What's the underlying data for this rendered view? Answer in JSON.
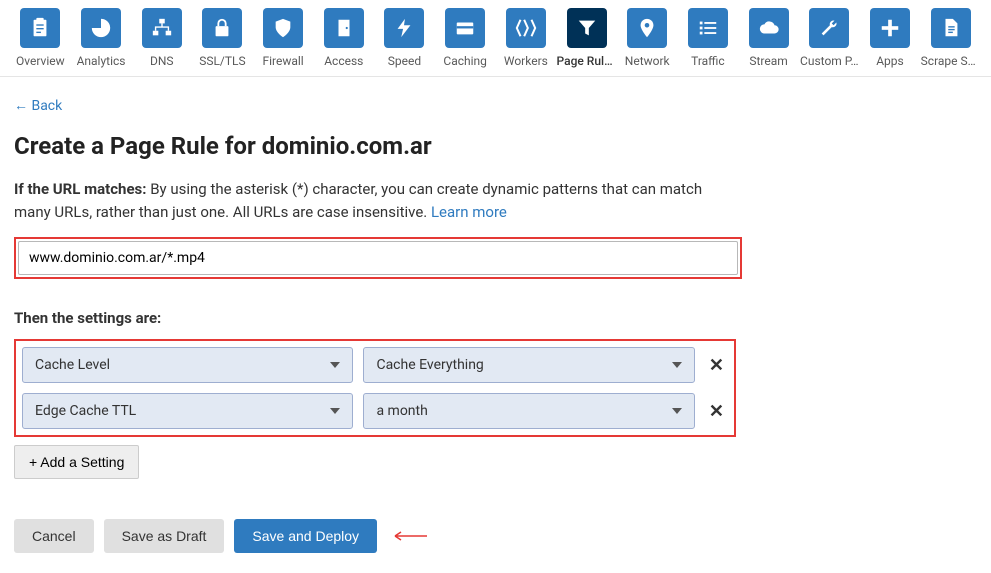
{
  "nav": {
    "items": [
      {
        "label": "Overview",
        "icon": "clipboard"
      },
      {
        "label": "Analytics",
        "icon": "pie"
      },
      {
        "label": "DNS",
        "icon": "sitemap"
      },
      {
        "label": "SSL/TLS",
        "icon": "lock"
      },
      {
        "label": "Firewall",
        "icon": "shield"
      },
      {
        "label": "Access",
        "icon": "door"
      },
      {
        "label": "Speed",
        "icon": "bolt"
      },
      {
        "label": "Caching",
        "icon": "card"
      },
      {
        "label": "Workers",
        "icon": "workers"
      },
      {
        "label": "Page Rules",
        "icon": "funnel",
        "active": true
      },
      {
        "label": "Network",
        "icon": "pin"
      },
      {
        "label": "Traffic",
        "icon": "list"
      },
      {
        "label": "Stream",
        "icon": "cloud"
      },
      {
        "label": "Custom P…",
        "icon": "wrench"
      },
      {
        "label": "Apps",
        "icon": "plus"
      },
      {
        "label": "Scrape Sh…",
        "icon": "doc"
      }
    ]
  },
  "back_label": "←  Back",
  "title": "Create a Page Rule for dominio.com.ar",
  "desc_bold": "If the URL matches:",
  "desc_rest": " By using the asterisk (*) character, you can create dynamic patterns that can match many URLs, rather than just one. All URLs are case insensitive. ",
  "learn_more": "Learn more",
  "url_value": "www.dominio.com.ar/*.mp4",
  "settings_heading": "Then the settings are:",
  "settings": [
    {
      "name": "Cache Level",
      "value": "Cache Everything"
    },
    {
      "name": "Edge Cache TTL",
      "value": "a month"
    }
  ],
  "add_setting_label": "+ Add a Setting",
  "buttons": {
    "cancel": "Cancel",
    "draft": "Save as Draft",
    "deploy": "Save and Deploy"
  }
}
